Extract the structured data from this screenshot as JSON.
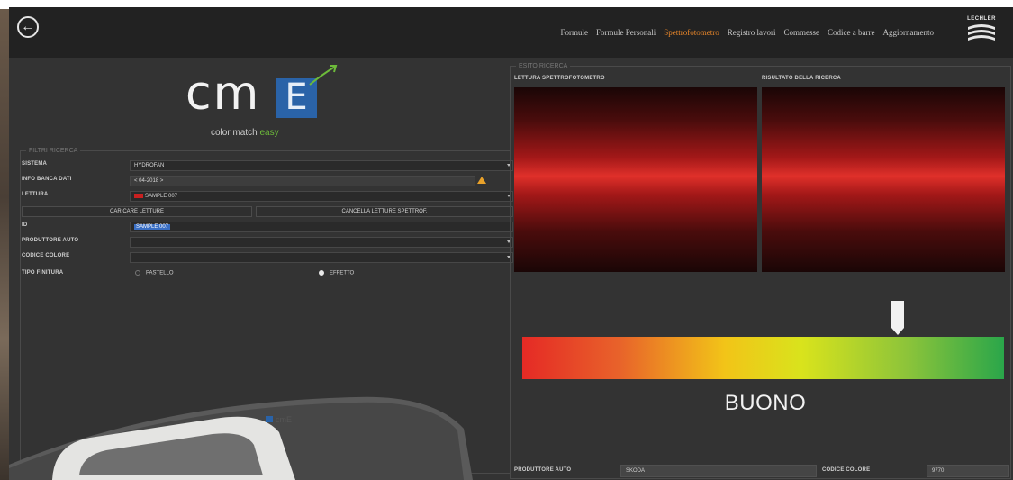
{
  "nav": {
    "items": [
      "Formule",
      "Formule Personali",
      "Spettrofotometro",
      "Registro lavori",
      "Commesse",
      "Codice a barre",
      "Aggiornamento"
    ],
    "active_index": 2,
    "accent_color": "#e8862a"
  },
  "brand": {
    "name": "LECHLER"
  },
  "logo": {
    "text": "cm",
    "letter": "E",
    "tagline_main": "color match",
    "tagline_accent": "easy"
  },
  "filters": {
    "legend": "FILTRI RICERCA",
    "sistema": {
      "label": "SISTEMA",
      "value": "HYDROFAN"
    },
    "info_banca_dati": {
      "label": "INFO BANCA DATI",
      "value": "< 04-2018 >"
    },
    "lettura": {
      "label": "LETTURA",
      "value": "SAMPLE 007"
    },
    "caricare_button": "CARICARE LETTURE",
    "cancella_button": "CANCELLA LETTURE SPETTROF.",
    "id": {
      "label": "ID",
      "value": "SAMPLE 007"
    },
    "produttore_auto": {
      "label": "PRODUTTORE AUTO",
      "value": ""
    },
    "codice_colore": {
      "label": "CODICE COLORE",
      "value": ""
    },
    "tipo_finitura": {
      "label": "TIPO FINITURA",
      "options": [
        "PASTELLO",
        "EFFETTO"
      ],
      "selected": "EFFETTO"
    }
  },
  "esito": {
    "legend": "ESITO RICERCA",
    "lettura_title": "LETTURA SPETTROFOTOMETRO",
    "risultato_title": "RISULTATO DELLA RICERCA",
    "match_color": "#e0302a",
    "gauge_level_percent": 78,
    "rating": "BUONO",
    "produttore_auto_label": "PRODUTTORE AUTO",
    "produttore_auto_value": "SKODA",
    "codice_colore_label": "CODICE COLORE",
    "codice_colore_value": "9770"
  },
  "device": {
    "label": "cmE"
  },
  "icons": {
    "back": "back-arrow-icon",
    "brand": "lechler-logo-icon",
    "warning": "warning-icon",
    "pointer": "gauge-pointer-icon"
  }
}
